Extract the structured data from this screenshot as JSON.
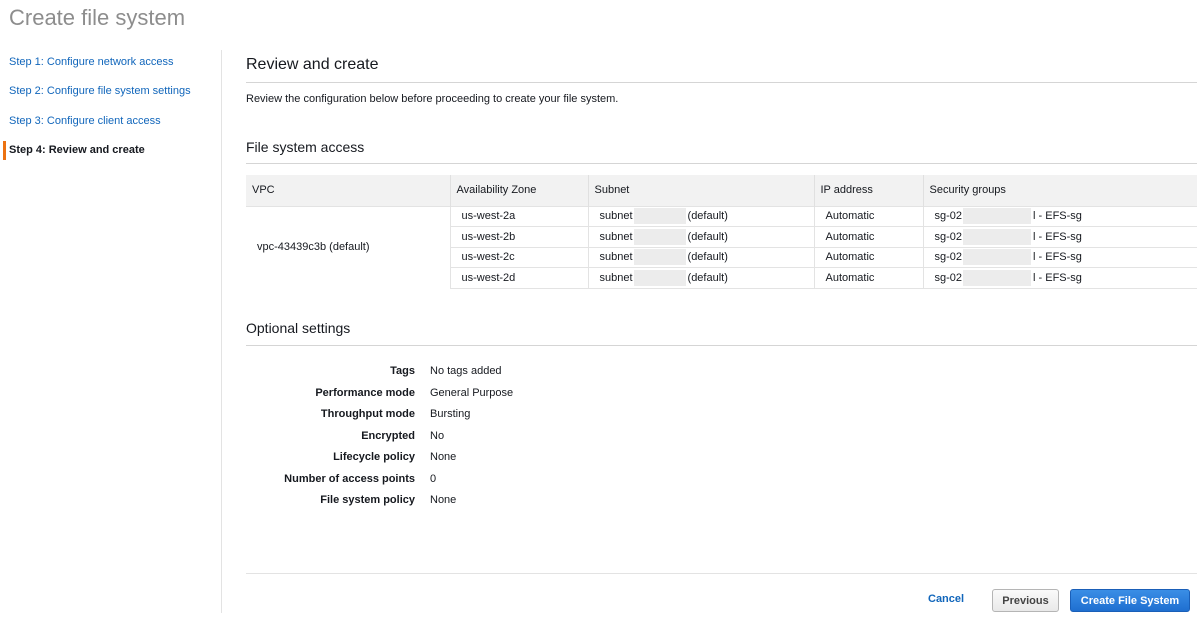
{
  "page": {
    "title": "Create file system"
  },
  "steps": [
    {
      "label": "Step 1: Configure network access"
    },
    {
      "label": "Step 2: Configure file system settings"
    },
    {
      "label": "Step 3: Configure client access"
    },
    {
      "label": "Step 4: Review and create"
    }
  ],
  "colors": {
    "link": "#1166bb",
    "active_marker": "#ec7211",
    "primary_button": "#1f6fd0"
  },
  "review": {
    "title": "Review and create",
    "intro": "Review the configuration below before proceeding to create your file system."
  },
  "access": {
    "title": "File system access",
    "columns": [
      "VPC",
      "Availability Zone",
      "Subnet",
      "IP address",
      "Security groups"
    ],
    "vpc": "vpc-43439c3b (default)",
    "rows": [
      {
        "az": "us-west-2a",
        "subnet_prefix": "subnet",
        "subnet_suffix": "(default)",
        "ip": "Automatic",
        "sg_prefix": "sg-02",
        "sg_suffix": "l - EFS-sg"
      },
      {
        "az": "us-west-2b",
        "subnet_prefix": "subnet",
        "subnet_suffix": "(default)",
        "ip": "Automatic",
        "sg_prefix": "sg-02",
        "sg_suffix": "l - EFS-sg"
      },
      {
        "az": "us-west-2c",
        "subnet_prefix": "subnet",
        "subnet_suffix": "(default)",
        "ip": "Automatic",
        "sg_prefix": "sg-02",
        "sg_suffix": "l - EFS-sg"
      },
      {
        "az": "us-west-2d",
        "subnet_prefix": "subnet",
        "subnet_suffix": "(default)",
        "ip": "Automatic",
        "sg_prefix": "sg-02",
        "sg_suffix": "l - EFS-sg"
      }
    ]
  },
  "optional": {
    "title": "Optional settings",
    "items": [
      {
        "label": "Tags",
        "value": "No tags added"
      },
      {
        "label": "Performance mode",
        "value": "General Purpose"
      },
      {
        "label": "Throughput mode",
        "value": "Bursting"
      },
      {
        "label": "Encrypted",
        "value": "No"
      },
      {
        "label": "Lifecycle policy",
        "value": "None"
      },
      {
        "label": "Number of access points",
        "value": "0"
      },
      {
        "label": "File system policy",
        "value": "None"
      }
    ]
  },
  "footer": {
    "cancel_label": "Cancel",
    "previous_label": "Previous",
    "create_label": "Create File System"
  }
}
